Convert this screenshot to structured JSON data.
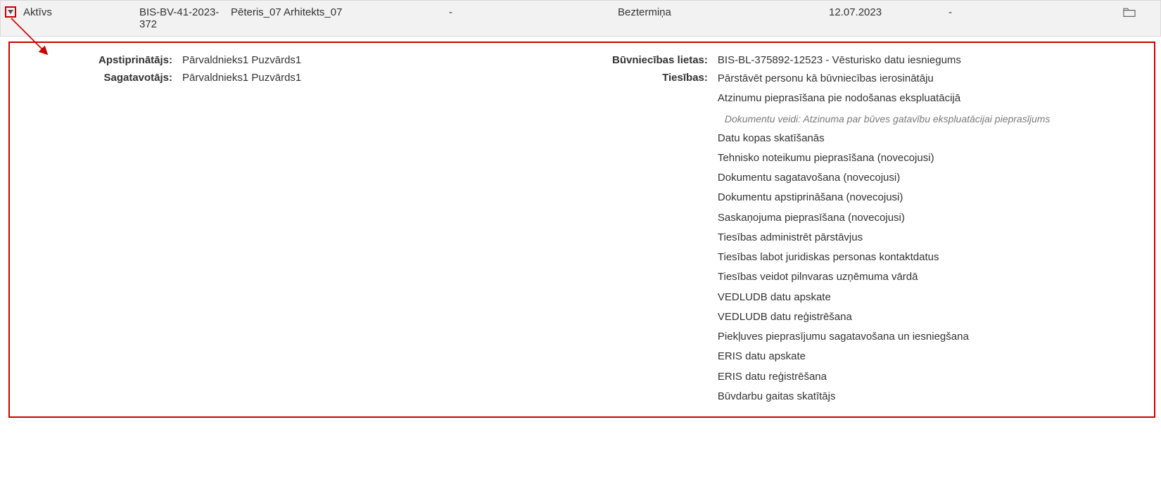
{
  "header": {
    "status": "Aktīvs",
    "number": "BIS-BV-41-2023-372",
    "person": "Pēteris_07 Arhitekts_07",
    "dash1": "-",
    "term": "Beztermiņa",
    "date": "12.07.2023",
    "dash2": "-"
  },
  "details": {
    "left": {
      "approver_label": "Apstiprinātājs:",
      "approver_value": "Pārvaldnieks1 Puzvārds1",
      "preparer_label": "Sagatavotājs:",
      "preparer_value": "Pārvaldnieks1 Puzvārds1"
    },
    "right": {
      "cases_label": "Būvniecības lietas:",
      "cases_value": "BIS-BL-375892-12523 - Vēsturisko datu iesniegums",
      "rights_label": "Tiesības:",
      "rights": [
        "Pārstāvēt personu kā būvniecības ierosinātāju",
        "Atzinumu pieprasīšana pie nodošanas ekspluatācijā",
        "Datu kopas skatīšanās",
        "Tehnisko noteikumu pieprasīšana (novecojusi)",
        "Dokumentu sagatavošana (novecojusi)",
        "Dokumentu apstiprināšana (novecojusi)",
        "Saskaņojuma pieprasīšana (novecojusi)",
        "Tiesības administrēt pārstāvjus",
        "Tiesības labot juridiskas personas kontaktdatus",
        "Tiesības veidot pilnvaras uzņēmuma vārdā",
        "VEDLUDB datu apskate",
        "VEDLUDB datu reģistrēšana",
        "Piekļuves pieprasījumu sagatavošana un iesniegšana",
        "ERIS datu apskate",
        "ERIS datu reģistrēšana",
        "Būvdarbu gaitas skatītājs"
      ],
      "rights_note_after_index": 1,
      "rights_note": "Dokumentu veidi: Atzinuma par būves gatavību ekspluatācijai pieprasījums"
    }
  }
}
